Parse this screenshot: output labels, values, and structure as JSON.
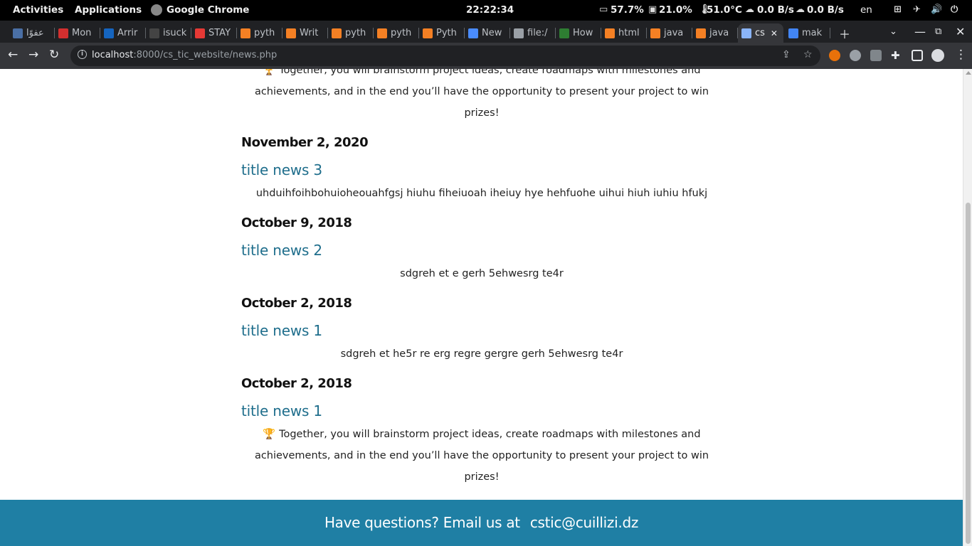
{
  "topbar": {
    "activities": "Activities",
    "applications": "Applications",
    "active_app": "Google Chrome",
    "clock": "22:22:34",
    "battery": "57.7%",
    "memory": "21.0%",
    "temperature": "51.0°C",
    "download": "0.0 B/s",
    "upload": "0.0 B/s",
    "language": "en"
  },
  "tabs": [
    {
      "label": "عفوًا",
      "icon": "car-icon",
      "color": "#4a6fa5"
    },
    {
      "label": "Mon",
      "icon": "maple-leaf-icon",
      "color": "#d32f2f"
    },
    {
      "label": "Arrir",
      "icon": "fleur-de-lis-icon",
      "color": "#1565c0"
    },
    {
      "label": "isuck",
      "icon": "github-icon",
      "color": "#444444"
    },
    {
      "label": "STAY",
      "icon": "target-icon",
      "color": "#e53935"
    },
    {
      "label": "pyth",
      "icon": "stackoverflow-icon",
      "color": "#f48024"
    },
    {
      "label": "Writ",
      "icon": "stackoverflow-icon",
      "color": "#f48024"
    },
    {
      "label": "pyth",
      "icon": "stackoverflow-icon",
      "color": "#f48024"
    },
    {
      "label": "pyth",
      "icon": "stackoverflow-icon",
      "color": "#f48024"
    },
    {
      "label": "Pyth",
      "icon": "stackoverflow-icon",
      "color": "#f48024"
    },
    {
      "label": "New",
      "icon": "stream-icon",
      "color": "#4a8cff"
    },
    {
      "label": "file:/",
      "icon": "link-icon",
      "color": "#9aa0a6"
    },
    {
      "label": "How",
      "icon": "glasses-icon",
      "color": "#2e7d32"
    },
    {
      "label": "html",
      "icon": "stackoverflow-icon",
      "color": "#f48024"
    },
    {
      "label": "java",
      "icon": "stackoverflow-icon",
      "color": "#f48024"
    },
    {
      "label": "java",
      "icon": "stackoverflow-icon",
      "color": "#f48024"
    },
    {
      "label": "cs",
      "icon": "link-icon",
      "color": "#8ab4f8",
      "active": true
    },
    {
      "label": "mak",
      "icon": "google-icon",
      "color": "#4285f4"
    }
  ],
  "toolbar": {
    "url_host": "localhost",
    "url_path": ":8000/cs_tic_website/news.php"
  },
  "news": {
    "top_text": "🏆 Together, you will brainstorm project ideas, create roadmaps with milestones and achievements, and in the end you’ll have the opportunity to present your project to win prizes!",
    "items": [
      {
        "date": "November 2, 2020",
        "title": "title news 3",
        "body": "uhduihfoihbohuioheouahfgsj hiuhu fiheiuoah iheiuy hye hehfuohe uihui hiuh iuhiu hfukj"
      },
      {
        "date": "October 9, 2018",
        "title": "title news 2",
        "body": "sdgreh et e gerh 5ehwesrg te4r"
      },
      {
        "date": "October 2, 2018",
        "title": "title news 1",
        "body": "sdgreh et he5r re erg regre gergre gerh 5ehwesrg te4r"
      },
      {
        "date": "October 2, 2018",
        "title": "title news 1",
        "body": "🏆 Together, you will brainstorm project ideas, create roadmaps with milestones and achievements, and in the end you’ll have the opportunity to present your project to win prizes!"
      }
    ]
  },
  "footer": {
    "prompt": "Have questions? Email us at",
    "email": "cstic@cuillizi.dz"
  }
}
